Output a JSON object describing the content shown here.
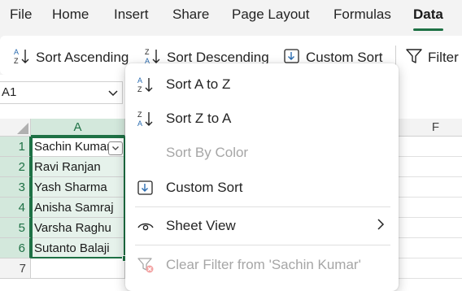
{
  "menubar": {
    "tabs": [
      {
        "label": "File"
      },
      {
        "label": "Home"
      },
      {
        "label": "Insert"
      },
      {
        "label": "Share"
      },
      {
        "label": "Page Layout"
      },
      {
        "label": "Formulas"
      },
      {
        "label": "Data"
      }
    ],
    "active_tab": "Data"
  },
  "ribbon": {
    "sort_ascending": "Sort Ascending",
    "sort_descending": "Sort Descending",
    "custom_sort": "Custom Sort",
    "filter": "Filter"
  },
  "namebox": {
    "value": "A1"
  },
  "grid": {
    "columns": [
      "A",
      "F"
    ],
    "rows": [
      "1",
      "2",
      "3",
      "4",
      "5",
      "6",
      "7"
    ],
    "cells": [
      "Sachin Kumar",
      "Ravi Ranjan",
      "Yash Sharma",
      "Anisha Samraj",
      "Varsha Raghu",
      "Sutanto Balaji"
    ]
  },
  "dropdown": {
    "sort_a_to_z": "Sort A to Z",
    "sort_z_to_a": "Sort Z to A",
    "sort_by_color": "Sort By Color",
    "custom_sort": "Custom Sort",
    "sheet_view": "Sheet View",
    "clear_filter": "Clear Filter from 'Sachin Kumar'"
  },
  "colors": {
    "accent": "#1e7145",
    "selection_fill": "#e6f2eb",
    "disabled_text": "#a6a6a6"
  }
}
